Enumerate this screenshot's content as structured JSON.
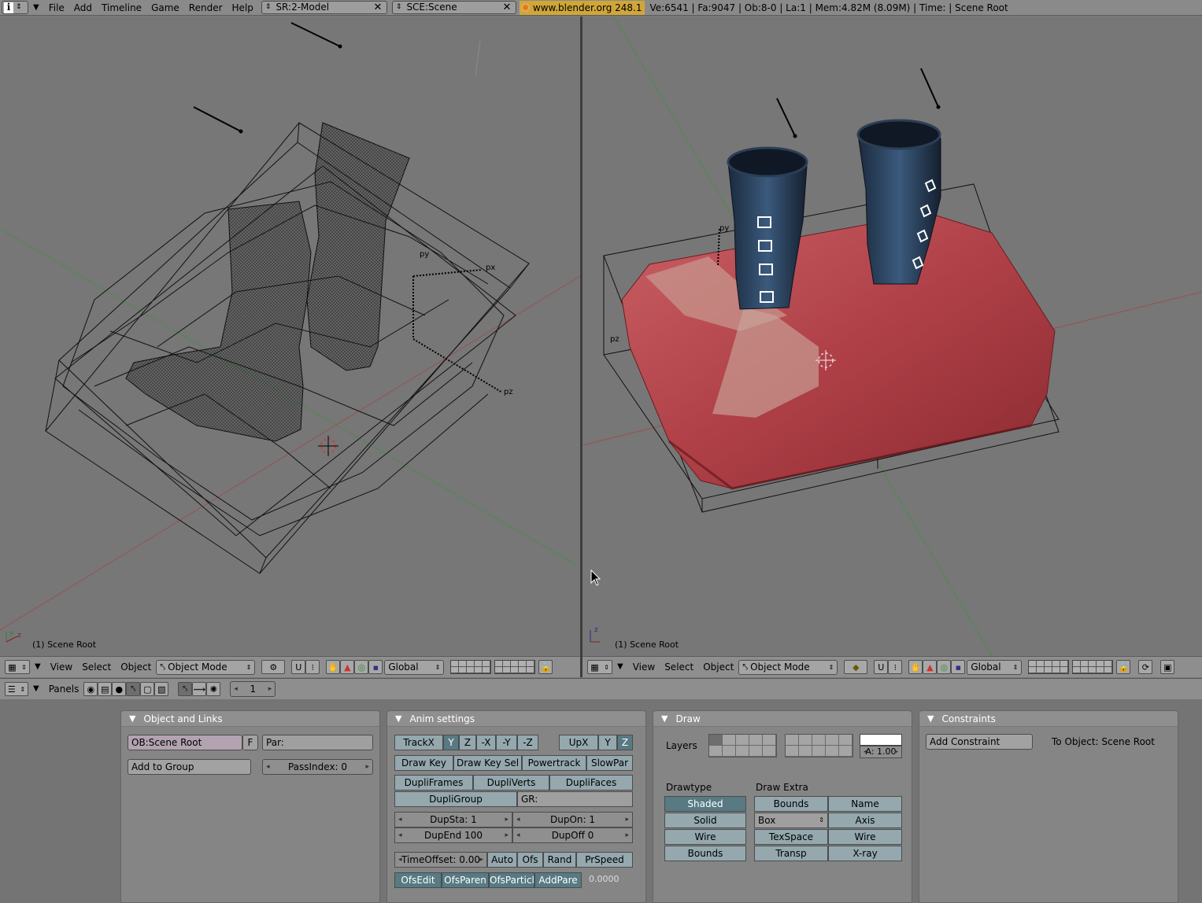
{
  "topbar": {
    "menu": [
      "File",
      "Add",
      "Timeline",
      "Game",
      "Render",
      "Help"
    ],
    "screen": "SR:2-Model",
    "scene": "SCE:Scene",
    "url": "www.blender.org 248.1",
    "stats": "Ve:6541 | Fa:9047 | Ob:8-0 | La:1  | Mem:4.82M (8.09M)  | Time: | Scene Root"
  },
  "viewport_left": {
    "label": "(1) Scene Root"
  },
  "viewport_right": {
    "label": "(1) Scene Root"
  },
  "header3d": {
    "view": "View",
    "select": "Select",
    "object": "Object",
    "mode": "Object Mode",
    "orientation": "Global"
  },
  "buttons_header": {
    "panels": "Panels",
    "frame": "1"
  },
  "object_links": {
    "title": "Object and Links",
    "ob_name": "OB:Scene Root",
    "f_label": "F",
    "par": "Par:",
    "add_group": "Add to Group",
    "passindex": "PassIndex: 0"
  },
  "anim": {
    "title": "Anim settings",
    "track": [
      "TrackX",
      "Y",
      "Z",
      "-X",
      "-Y",
      "-Z"
    ],
    "up": [
      "UpX",
      "Y",
      "Z"
    ],
    "row2": [
      "Draw Key",
      "Draw Key Sel",
      "Powertrack",
      "SlowPar"
    ],
    "row3": [
      "DupliFrames",
      "DupliVerts",
      "DupliFaces"
    ],
    "dupligroup": "DupliGroup",
    "gr": "GR:",
    "dupsta": "DupSta: 1",
    "dupon": "DupOn: 1",
    "dupend": "DupEnd 100",
    "dupoff": "DupOff 0",
    "timeoffset": "TimeOffset: 0.00",
    "row_time": [
      "Auto",
      "Ofs",
      "Rand",
      "PrSpeed"
    ],
    "row_ofs": [
      "OfsEdit",
      "OfsParen",
      "OfsParticl",
      "AddPare"
    ],
    "zero": "0.0000"
  },
  "draw": {
    "title": "Draw",
    "layers": "Layers",
    "alpha": "A: 1.00",
    "drawtype": "Drawtype",
    "drawextra": "Draw Extra",
    "types": [
      "Shaded",
      "Solid",
      "Wire",
      "Bounds"
    ],
    "extra_left": [
      "Bounds",
      "Box",
      "TexSpace",
      "Transp"
    ],
    "extra_right": [
      "Name",
      "Axis",
      "Wire",
      "X-ray"
    ]
  },
  "constraints": {
    "title": "Constraints",
    "add": "Add Constraint",
    "to_object": "To Object: Scene Root"
  },
  "axes": {
    "py": "py",
    "px": "px",
    "pz": "pz",
    "y": "y",
    "z": "z",
    "x": "x"
  }
}
